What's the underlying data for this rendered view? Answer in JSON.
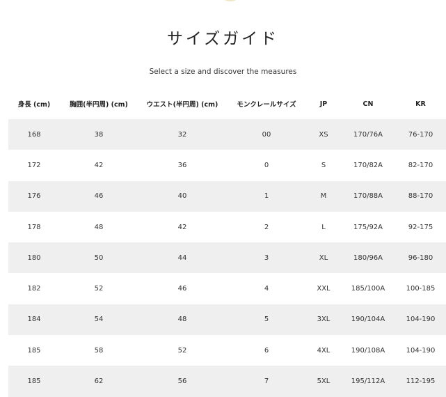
{
  "page": {
    "title": "サイズガイド",
    "subtitle": "Select a size and discover the measures"
  },
  "table": {
    "headers": [
      "身長 (cm)",
      "胸囲(半円周) (cm)",
      "ウエスト(半円周) (cm)",
      "モンクレールサイズ",
      "JP",
      "CN",
      "KR"
    ],
    "rows": [
      [
        "168",
        "38",
        "32",
        "00",
        "XS",
        "170/76A",
        "76-170"
      ],
      [
        "172",
        "42",
        "36",
        "0",
        "S",
        "170/82A",
        "82-170"
      ],
      [
        "176",
        "46",
        "40",
        "1",
        "M",
        "170/88A",
        "88-170"
      ],
      [
        "178",
        "48",
        "42",
        "2",
        "L",
        "175/92A",
        "92-175"
      ],
      [
        "180",
        "50",
        "44",
        "3",
        "XL",
        "180/96A",
        "96-180"
      ],
      [
        "182",
        "52",
        "46",
        "4",
        "XXL",
        "185/100A",
        "100-185"
      ],
      [
        "184",
        "54",
        "48",
        "5",
        "3XL",
        "190/104A",
        "104-190"
      ],
      [
        "185",
        "58",
        "52",
        "6",
        "4XL",
        "190/108A",
        "104-190"
      ],
      [
        "185",
        "62",
        "56",
        "7",
        "5XL",
        "195/112A",
        "112-195"
      ]
    ]
  },
  "colors": {
    "row_shade": "#efefef",
    "text": "#222222"
  }
}
